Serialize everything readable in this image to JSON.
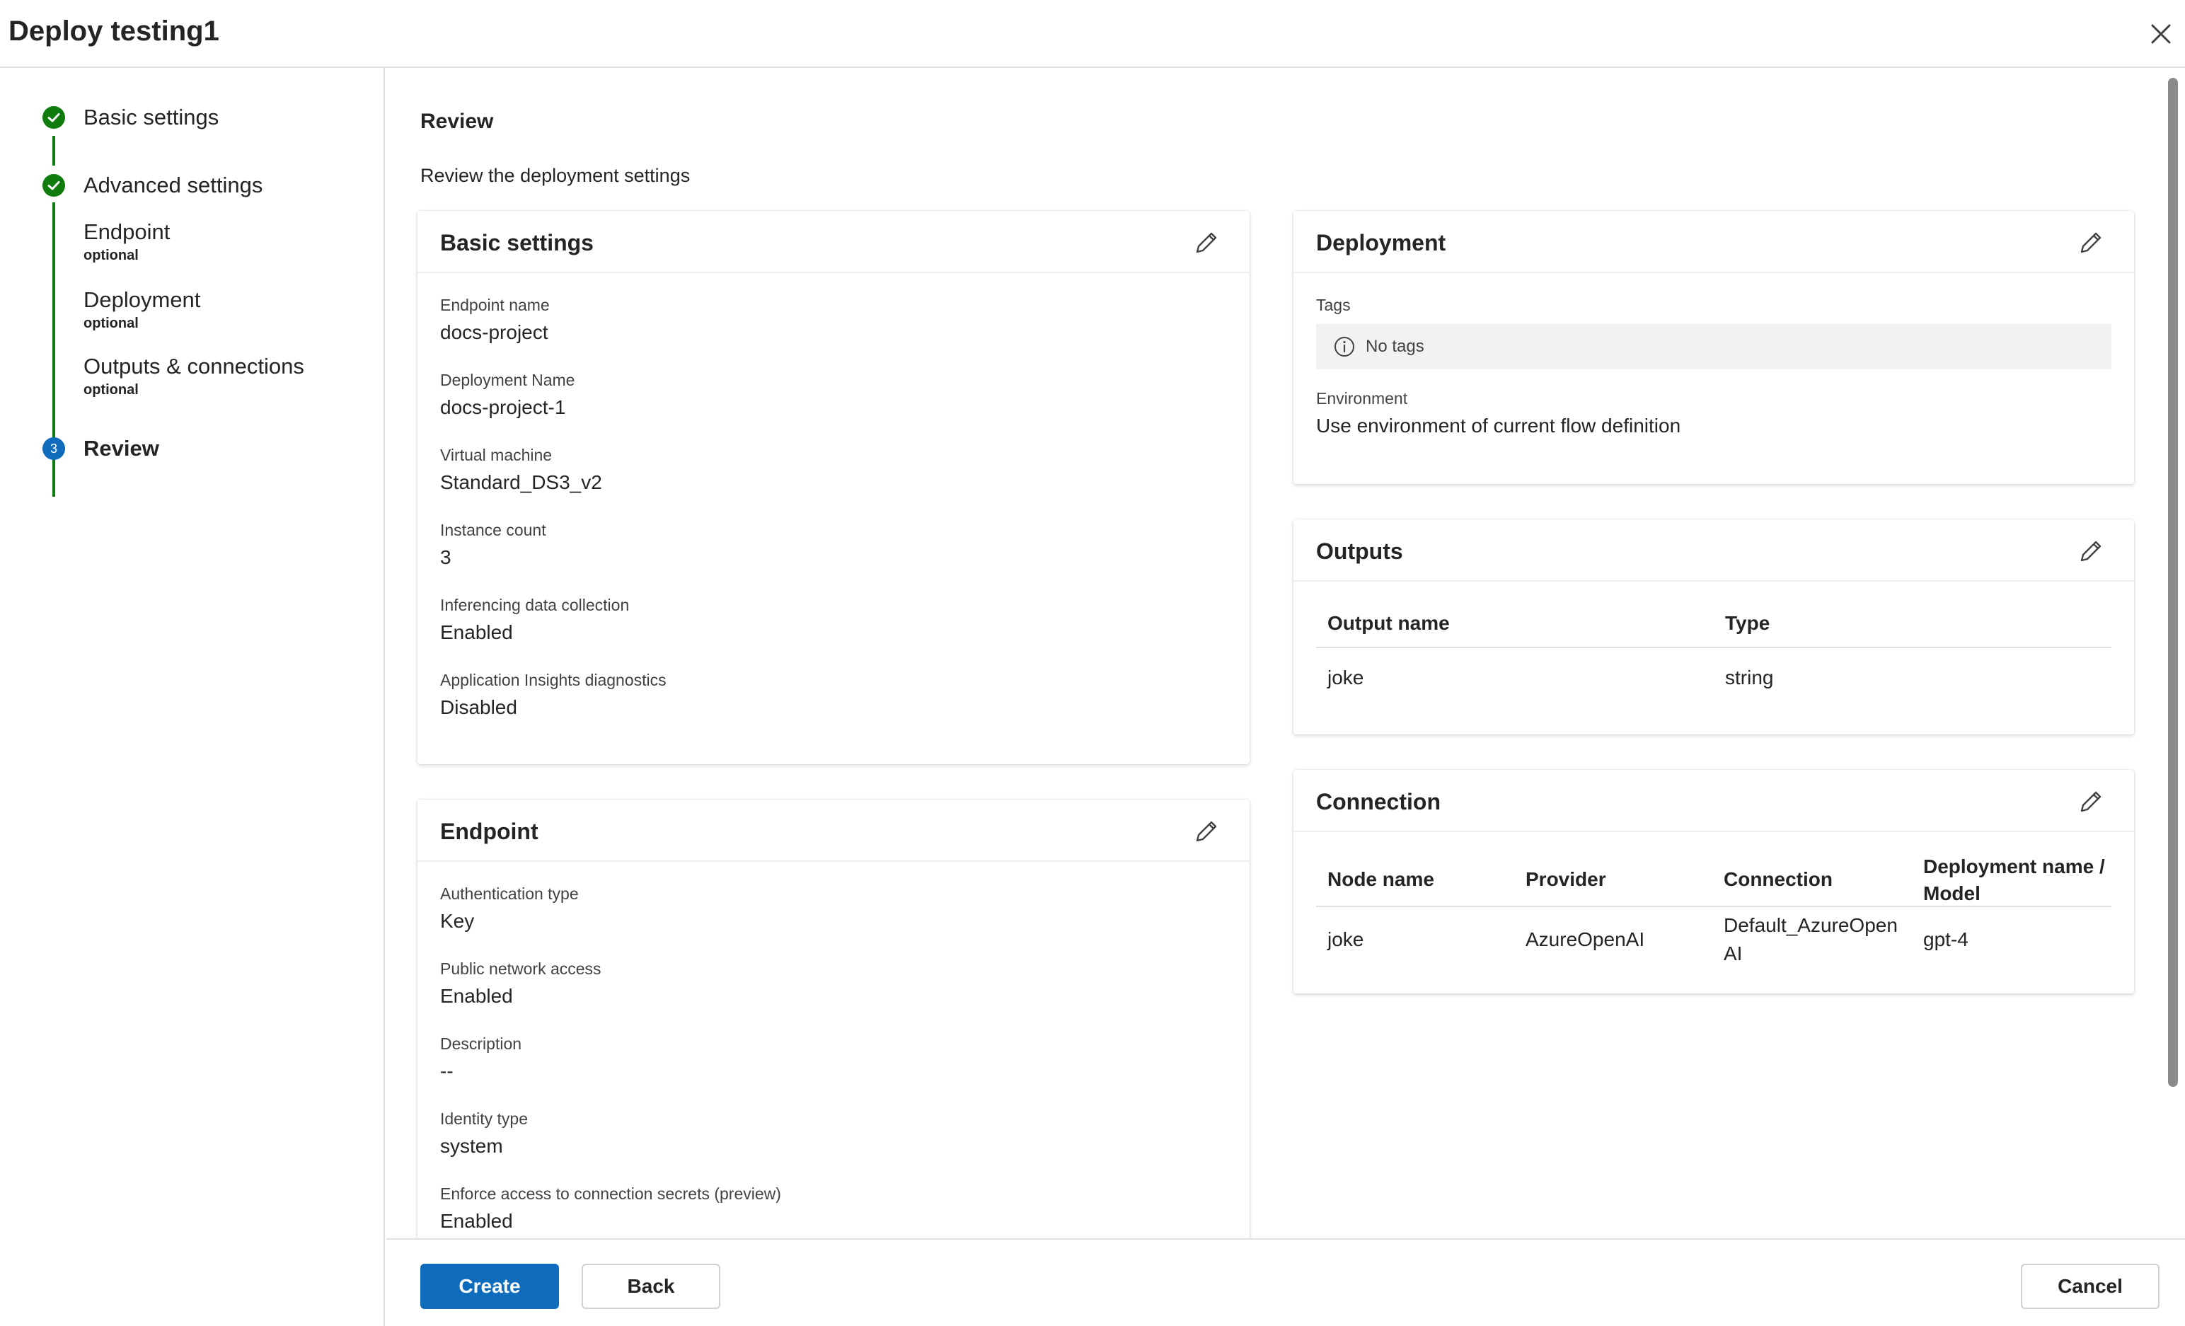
{
  "header": {
    "title": "Deploy testing1"
  },
  "steps": {
    "basic": "Basic settings",
    "advanced": "Advanced settings",
    "endpoint": "Endpoint",
    "deployment": "Deployment",
    "outputs": "Outputs & connections",
    "optional": "optional",
    "review": "Review",
    "review_number": "3"
  },
  "review": {
    "title": "Review",
    "description": "Review the deployment settings"
  },
  "basic_card": {
    "title": "Basic settings",
    "fields": [
      {
        "label": "Endpoint name",
        "value": "docs-project"
      },
      {
        "label": "Deployment Name",
        "value": "docs-project-1"
      },
      {
        "label": "Virtual machine",
        "value": "Standard_DS3_v2"
      },
      {
        "label": "Instance count",
        "value": "3"
      },
      {
        "label": "Inferencing data collection",
        "value": "Enabled"
      },
      {
        "label": "Application Insights diagnostics",
        "value": "Disabled"
      }
    ]
  },
  "endpoint_card": {
    "title": "Endpoint",
    "fields": [
      {
        "label": "Authentication type",
        "value": "Key"
      },
      {
        "label": "Public network access",
        "value": "Enabled"
      },
      {
        "label": "Description",
        "value": "--"
      },
      {
        "label": "Identity type",
        "value": "system"
      },
      {
        "label": "Enforce access to connection secrets (preview)",
        "value": "Enabled"
      }
    ]
  },
  "deployment_card": {
    "title": "Deployment",
    "tags_label": "Tags",
    "tags_value": "No tags",
    "environment_label": "Environment",
    "environment_value": "Use environment of current flow definition"
  },
  "outputs_card": {
    "title": "Outputs",
    "columns": [
      "Output name",
      "Type"
    ],
    "rows": [
      [
        "joke",
        "string"
      ]
    ]
  },
  "connection_card": {
    "title": "Connection",
    "columns": [
      "Node name",
      "Provider",
      "Connection",
      "Deployment name / Model"
    ],
    "rows": [
      [
        "joke",
        "AzureOpenAI",
        "Default_AzureOpenAI",
        "gpt-4"
      ]
    ]
  },
  "footer": {
    "create": "Create",
    "back": "Back",
    "cancel": "Cancel"
  },
  "colors": {
    "accent": "#0f6cbd",
    "success": "#107c10"
  },
  "icons": {
    "close": "close-icon",
    "edit": "pencil-icon",
    "done": "checkmark-circle-icon",
    "info": "info-icon"
  }
}
